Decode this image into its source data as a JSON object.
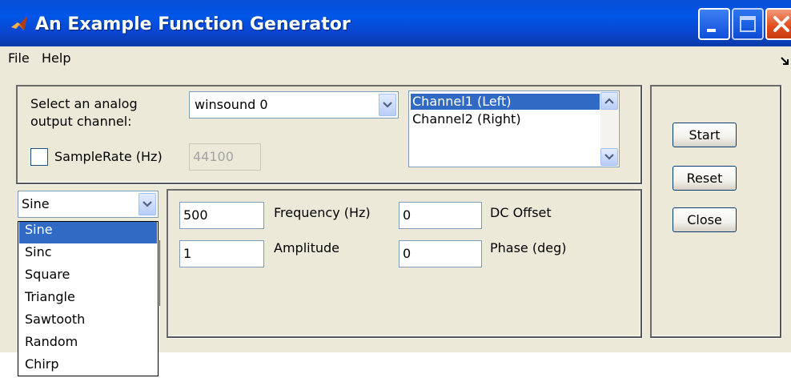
{
  "window": {
    "title": "An Example Function Generator",
    "controls": {
      "minimize": "minimize-icon",
      "maximize": "maximize-icon",
      "close": "close-icon"
    }
  },
  "menubar": {
    "items": [
      "File",
      "Help"
    ]
  },
  "output_panel": {
    "select_label_line1": "Select an analog",
    "select_label_line2": "output channel:",
    "device_value": "winsound 0",
    "samplerate_label": "SampleRate (Hz)",
    "samplerate_checked": false,
    "samplerate_value": "44100",
    "channels": [
      "Channel1 (Left)",
      "Channel2 (Right)"
    ],
    "selected_channel": "Channel1 (Left)"
  },
  "waveform": {
    "selected": "Sine",
    "options": [
      "Sine",
      "Sinc",
      "Square",
      "Triangle",
      "Sawtooth",
      "Random",
      "Chirp"
    ]
  },
  "params": {
    "frequency_label": "Frequency (Hz)",
    "frequency_value": "500",
    "amplitude_label": "Amplitude",
    "amplitude_value": "1",
    "dc_offset_label": "DC Offset",
    "dc_offset_value": "0",
    "phase_label": "Phase (deg)",
    "phase_value": "0"
  },
  "buttons": {
    "start": "Start",
    "reset": "Reset",
    "close": "Close"
  },
  "colors": {
    "titlebar": "#0054e3",
    "selection": "#316ac5",
    "window_bg": "#ece9d8"
  }
}
